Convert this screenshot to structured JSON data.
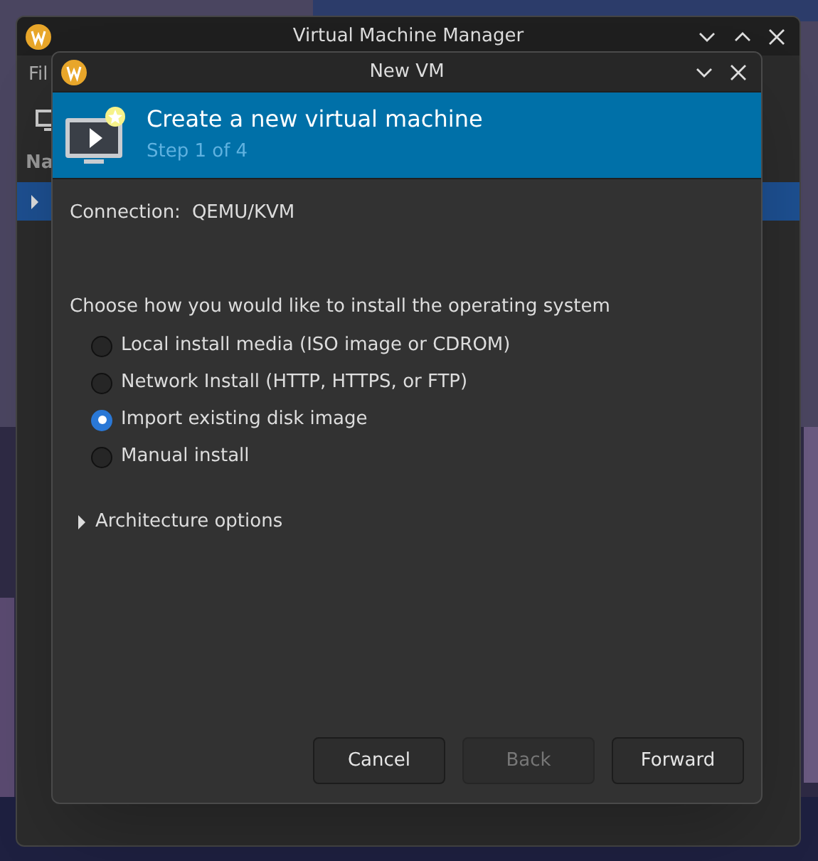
{
  "main_window": {
    "title": "Virtual Machine Manager",
    "menu": [
      "Fil"
    ],
    "column_header": "Na",
    "row_expanded": false,
    "row_selected": true
  },
  "dialog": {
    "title": "New VM",
    "banner": {
      "title": "Create a new virtual machine",
      "subtitle": "Step 1 of 4"
    },
    "connection": {
      "label": "Connection:",
      "value": "QEMU/KVM"
    },
    "prompt": "Choose how you would like to install the operating system",
    "options": [
      {
        "label": "Local install media (ISO image or CDROM)",
        "selected": false
      },
      {
        "label": "Network Install (HTTP, HTTPS, or FTP)",
        "selected": false
      },
      {
        "label": "Import existing disk image",
        "selected": true
      },
      {
        "label": "Manual install",
        "selected": false
      }
    ],
    "expander": {
      "label": "Architecture options",
      "expanded": false
    },
    "buttons": [
      {
        "label": "Cancel",
        "disabled": false
      },
      {
        "label": "Back",
        "disabled": true
      },
      {
        "label": "Forward",
        "disabled": false
      }
    ]
  }
}
